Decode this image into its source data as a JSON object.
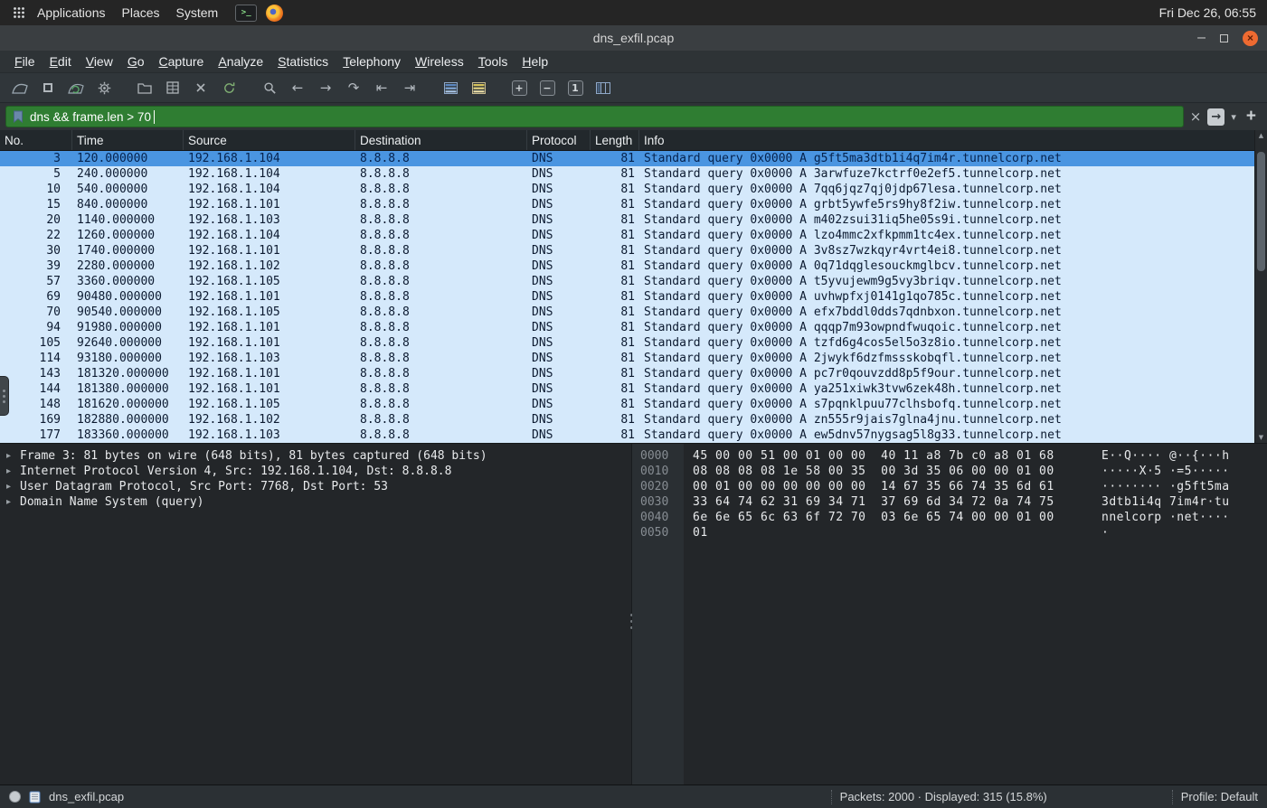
{
  "desktop_bar": {
    "menus": [
      "Applications",
      "Places",
      "System"
    ],
    "clock": "Fri Dec 26, 06:55"
  },
  "window": {
    "title": "dns_exfil.pcap",
    "controls": {
      "minimize": "–",
      "close": "×"
    }
  },
  "menu_bar": {
    "items": [
      "File",
      "Edit",
      "View",
      "Go",
      "Capture",
      "Analyze",
      "Statistics",
      "Telephony",
      "Wireless",
      "Tools",
      "Help"
    ]
  },
  "filter_bar": {
    "value": "dns && frame.len > 70",
    "clear_glyph": "×",
    "apply_glyph": "→",
    "dropdown_glyph": "▾",
    "add_glyph": "+"
  },
  "icons": {
    "expander": "▸",
    "terminal_prompt": ">_",
    "go_back": "←",
    "go_forward": "→",
    "go_to": "↷",
    "go_first": "⇤",
    "go_last": "⇥",
    "zoom_in": "+",
    "zoom_out": "−",
    "zoom_reset": "1",
    "scroll_up": "▲",
    "scroll_down": "▼"
  },
  "packet_list": {
    "columns": [
      "No.",
      "Time",
      "Source",
      "Destination",
      "Protocol",
      "Length",
      "Info"
    ],
    "rows": [
      {
        "no": "3",
        "time": "120.000000",
        "source": "192.168.1.104",
        "destination": "8.8.8.8",
        "protocol": "DNS",
        "length": "81",
        "info": "Standard query 0x0000 A g5ft5ma3dtb1i4q7im4r.tunnelcorp.net",
        "selected": true
      },
      {
        "no": "5",
        "time": "240.000000",
        "source": "192.168.1.104",
        "destination": "8.8.8.8",
        "protocol": "DNS",
        "length": "81",
        "info": "Standard query 0x0000 A 3arwfuze7kctrf0e2ef5.tunnelcorp.net"
      },
      {
        "no": "10",
        "time": "540.000000",
        "source": "192.168.1.104",
        "destination": "8.8.8.8",
        "protocol": "DNS",
        "length": "81",
        "info": "Standard query 0x0000 A 7qq6jqz7qj0jdp67lesa.tunnelcorp.net"
      },
      {
        "no": "15",
        "time": "840.000000",
        "source": "192.168.1.101",
        "destination": "8.8.8.8",
        "protocol": "DNS",
        "length": "81",
        "info": "Standard query 0x0000 A grbt5ywfe5rs9hy8f2iw.tunnelcorp.net"
      },
      {
        "no": "20",
        "time": "1140.000000",
        "source": "192.168.1.103",
        "destination": "8.8.8.8",
        "protocol": "DNS",
        "length": "81",
        "info": "Standard query 0x0000 A m402zsui31iq5he05s9i.tunnelcorp.net"
      },
      {
        "no": "22",
        "time": "1260.000000",
        "source": "192.168.1.104",
        "destination": "8.8.8.8",
        "protocol": "DNS",
        "length": "81",
        "info": "Standard query 0x0000 A lzo4mmc2xfkpmm1tc4ex.tunnelcorp.net"
      },
      {
        "no": "30",
        "time": "1740.000000",
        "source": "192.168.1.101",
        "destination": "8.8.8.8",
        "protocol": "DNS",
        "length": "81",
        "info": "Standard query 0x0000 A 3v8sz7wzkqyr4vrt4ei8.tunnelcorp.net"
      },
      {
        "no": "39",
        "time": "2280.000000",
        "source": "192.168.1.102",
        "destination": "8.8.8.8",
        "protocol": "DNS",
        "length": "81",
        "info": "Standard query 0x0000 A 0q71dqglesouckmglbcv.tunnelcorp.net"
      },
      {
        "no": "57",
        "time": "3360.000000",
        "source": "192.168.1.105",
        "destination": "8.8.8.8",
        "protocol": "DNS",
        "length": "81",
        "info": "Standard query 0x0000 A t5yvujewm9g5vy3briqv.tunnelcorp.net"
      },
      {
        "no": "69",
        "time": "90480.000000",
        "source": "192.168.1.101",
        "destination": "8.8.8.8",
        "protocol": "DNS",
        "length": "81",
        "info": "Standard query 0x0000 A uvhwpfxj0141g1qo785c.tunnelcorp.net"
      },
      {
        "no": "70",
        "time": "90540.000000",
        "source": "192.168.1.105",
        "destination": "8.8.8.8",
        "protocol": "DNS",
        "length": "81",
        "info": "Standard query 0x0000 A efx7bddl0dds7qdnbxon.tunnelcorp.net"
      },
      {
        "no": "94",
        "time": "91980.000000",
        "source": "192.168.1.101",
        "destination": "8.8.8.8",
        "protocol": "DNS",
        "length": "81",
        "info": "Standard query 0x0000 A qqqp7m93owpndfwuqoic.tunnelcorp.net"
      },
      {
        "no": "105",
        "time": "92640.000000",
        "source": "192.168.1.101",
        "destination": "8.8.8.8",
        "protocol": "DNS",
        "length": "81",
        "info": "Standard query 0x0000 A tzfd6g4cos5el5o3z8io.tunnelcorp.net"
      },
      {
        "no": "114",
        "time": "93180.000000",
        "source": "192.168.1.103",
        "destination": "8.8.8.8",
        "protocol": "DNS",
        "length": "81",
        "info": "Standard query 0x0000 A 2jwykf6dzfmssskobqfl.tunnelcorp.net"
      },
      {
        "no": "143",
        "time": "181320.000000",
        "source": "192.168.1.101",
        "destination": "8.8.8.8",
        "protocol": "DNS",
        "length": "81",
        "info": "Standard query 0x0000 A pc7r0qouvzdd8p5f9our.tunnelcorp.net"
      },
      {
        "no": "144",
        "time": "181380.000000",
        "source": "192.168.1.101",
        "destination": "8.8.8.8",
        "protocol": "DNS",
        "length": "81",
        "info": "Standard query 0x0000 A ya251xiwk3tvw6zek48h.tunnelcorp.net"
      },
      {
        "no": "148",
        "time": "181620.000000",
        "source": "192.168.1.105",
        "destination": "8.8.8.8",
        "protocol": "DNS",
        "length": "81",
        "info": "Standard query 0x0000 A s7pqnklpuu77clhsbofq.tunnelcorp.net"
      },
      {
        "no": "169",
        "time": "182880.000000",
        "source": "192.168.1.102",
        "destination": "8.8.8.8",
        "protocol": "DNS",
        "length": "81",
        "info": "Standard query 0x0000 A zn555r9jais7glna4jnu.tunnelcorp.net"
      },
      {
        "no": "177",
        "time": "183360.000000",
        "source": "192.168.1.103",
        "destination": "8.8.8.8",
        "protocol": "DNS",
        "length": "81",
        "info": "Standard query 0x0000 A ew5dnv57nygsag5l8g33.tunnelcorp.net"
      }
    ]
  },
  "details_pane": {
    "lines": [
      "Frame 3: 81 bytes on wire (648 bits), 81 bytes captured (648 bits)",
      "Internet Protocol Version 4, Src: 192.168.1.104, Dst: 8.8.8.8",
      "User Datagram Protocol, Src Port: 7768, Dst Port: 53",
      "Domain Name System (query)"
    ]
  },
  "hex_pane": {
    "rows": [
      {
        "offset": "0000",
        "hex": "45 00 00 51 00 01 00 00  40 11 a8 7b c0 a8 01 68",
        "ascii": "E··Q···· @··{···h"
      },
      {
        "offset": "0010",
        "hex": "08 08 08 08 1e 58 00 35  00 3d 35 06 00 00 01 00",
        "ascii": "·····X·5 ·=5·····"
      },
      {
        "offset": "0020",
        "hex": "00 01 00 00 00 00 00 00  14 67 35 66 74 35 6d 61",
        "ascii": "········ ·g5ft5ma"
      },
      {
        "offset": "0030",
        "hex": "33 64 74 62 31 69 34 71  37 69 6d 34 72 0a 74 75",
        "ascii": "3dtb1i4q 7im4r·tu"
      },
      {
        "offset": "0040",
        "hex": "6e 6e 65 6c 63 6f 72 70  03 6e 65 74 00 00 01 00",
        "ascii": "nnelcorp ·net····"
      },
      {
        "offset": "0050",
        "hex": "01",
        "ascii": "·"
      }
    ]
  },
  "status_bar": {
    "filename": "dns_exfil.pcap",
    "packets_info": "Packets: 2000 · Displayed: 315 (15.8%)",
    "profile": "Profile: Default"
  }
}
